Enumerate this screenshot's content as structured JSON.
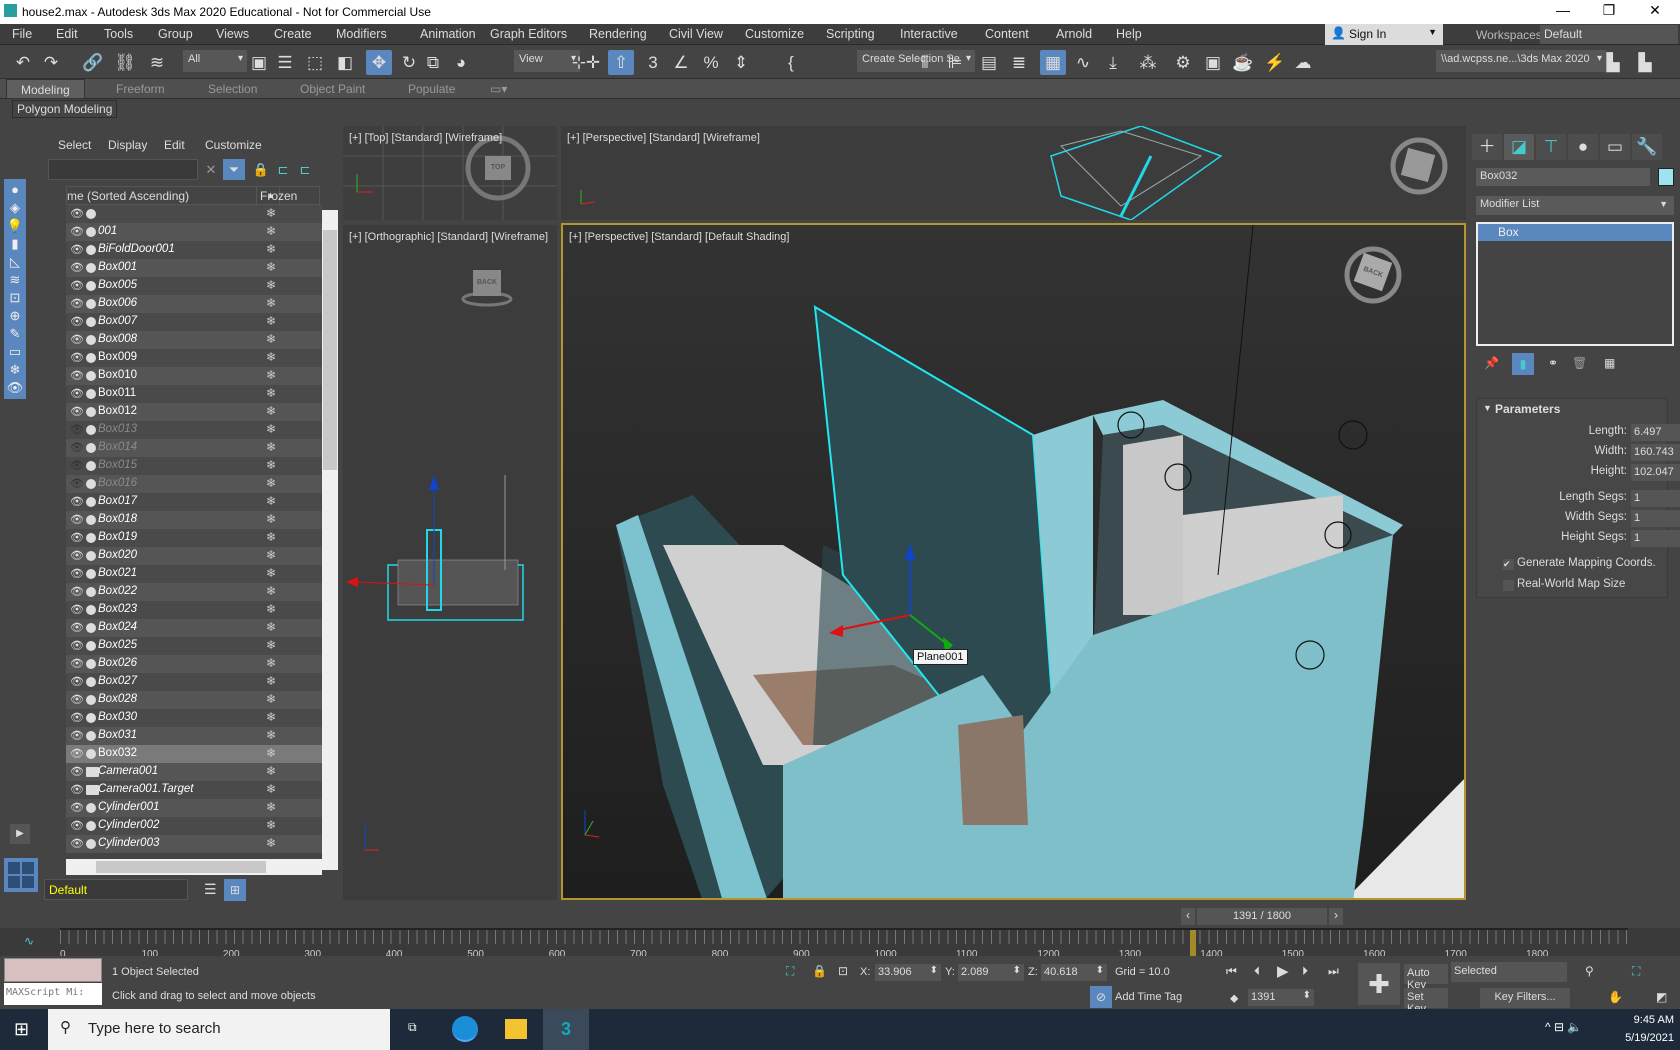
{
  "window": {
    "title": "house2.max - Autodesk 3ds Max 2020 Educational - Not for Commercial Use",
    "controls": [
      "—",
      "❐",
      "✕"
    ]
  },
  "menu": [
    "File",
    "Edit",
    "Tools",
    "Group",
    "Views",
    "Create",
    "Modifiers",
    "Animation",
    "Graph Editors",
    "Rendering",
    "Civil View",
    "Customize",
    "Scripting",
    "Interactive",
    "Content",
    "Arnold",
    "Help"
  ],
  "signin": "Sign In",
  "workspaces": {
    "label": "Workspaces:",
    "value": "Default"
  },
  "toolbar": {
    "filter": "All",
    "refcoord": "View",
    "selset": "Create Selection Se",
    "project": "\\\\ad.wcpss.ne...\\3ds Max 2020",
    "icons": [
      "undo",
      "redo",
      "link",
      "unlink",
      "bind-space-warp",
      "select",
      "select-by-name",
      "rect-region",
      "window-crossing",
      "move",
      "rotate",
      "scale",
      "placement",
      "pivot",
      "snap-toggle",
      "manipulate",
      "snaps-3d",
      "angle-snap",
      "percent-snap",
      "spinner-snap",
      "edit-named-sets",
      "mirror",
      "align",
      "toggle-scene-explorer",
      "toggle-layer-explorer",
      "toggle-ribbon",
      "curve-editor",
      "schematic-view",
      "material-editor",
      "render-setup",
      "rendered-frame-window",
      "render",
      "render-iterative",
      "render-in-cloud",
      "project-folder",
      "set-project"
    ]
  },
  "ribbon": {
    "tabs": [
      "Modeling",
      "Freeform",
      "Selection",
      "Object Paint",
      "Populate"
    ],
    "active": "Modeling",
    "panel": "Polygon Modeling"
  },
  "explorer": {
    "menus": [
      "Select",
      "Display",
      "Edit",
      "Customize"
    ],
    "column_name": "me (Sorted Ascending)",
    "column_frozen": "Frozen",
    "rows": [
      {
        "name": "",
        "italic": false
      },
      {
        "name": "001",
        "italic": true
      },
      {
        "name": "BiFoldDoor001",
        "italic": true
      },
      {
        "name": "Box001",
        "italic": true
      },
      {
        "name": "Box005",
        "italic": true
      },
      {
        "name": "Box006",
        "italic": true
      },
      {
        "name": "Box007",
        "italic": true
      },
      {
        "name": "Box008",
        "italic": true
      },
      {
        "name": "Box009",
        "italic": false
      },
      {
        "name": "Box010",
        "italic": false
      },
      {
        "name": "Box011",
        "italic": false
      },
      {
        "name": "Box012",
        "italic": false
      },
      {
        "name": "Box013",
        "italic": true,
        "hidden": true
      },
      {
        "name": "Box014",
        "italic": true,
        "hidden": true
      },
      {
        "name": "Box015",
        "italic": true,
        "hidden": true
      },
      {
        "name": "Box016",
        "italic": true,
        "hidden": true
      },
      {
        "name": "Box017",
        "italic": true
      },
      {
        "name": "Box018",
        "italic": true
      },
      {
        "name": "Box019",
        "italic": true
      },
      {
        "name": "Box020",
        "italic": true
      },
      {
        "name": "Box021",
        "italic": true
      },
      {
        "name": "Box022",
        "italic": true
      },
      {
        "name": "Box023",
        "italic": true
      },
      {
        "name": "Box024",
        "italic": true
      },
      {
        "name": "Box025",
        "italic": true
      },
      {
        "name": "Box026",
        "italic": true
      },
      {
        "name": "Box027",
        "italic": true
      },
      {
        "name": "Box028",
        "italic": true
      },
      {
        "name": "Box030",
        "italic": true
      },
      {
        "name": "Box031",
        "italic": true
      },
      {
        "name": "Box032",
        "italic": false,
        "selected": true
      },
      {
        "name": "Camera001",
        "italic": true,
        "camera": true
      },
      {
        "name": "Camera001.Target",
        "italic": true,
        "camera": true
      },
      {
        "name": "Cylinder001",
        "italic": true
      },
      {
        "name": "Cylinder002",
        "italic": true
      },
      {
        "name": "Cylinder003",
        "italic": true
      }
    ],
    "layer": "Default"
  },
  "viewports": {
    "top": "[+] [Top] [Standard] [Wireframe]",
    "persp_wire": "[+] [Perspective] [Standard] [Wireframe]",
    "ortho": "[+] [Orthographic] [Standard] [Wireframe]",
    "persp_main": "[+] [Perspective] [Standard] [Default Shading]",
    "tooltip": "Plane001",
    "viewcube_top": "TOP",
    "viewcube_back": "BACK"
  },
  "command_panel": {
    "object_name": "Box032",
    "object_color": "#9ee4ee",
    "modifier_list": "Modifier List",
    "stack": [
      "Box"
    ],
    "rollout": "Parameters",
    "params": [
      {
        "label": "Length:",
        "value": "6.497"
      },
      {
        "label": "Width:",
        "value": "160.743"
      },
      {
        "label": "Height:",
        "value": "102.047"
      },
      {
        "label": "Length Segs:",
        "value": "1"
      },
      {
        "label": "Width Segs:",
        "value": "1"
      },
      {
        "label": "Height Segs:",
        "value": "1"
      }
    ],
    "gen_mapping": {
      "label": "Generate Mapping Coords.",
      "checked": true
    },
    "real_world": {
      "label": "Real-World Map Size",
      "checked": false
    }
  },
  "timeline": {
    "frame": "1391 / 1800",
    "current": 1391,
    "max": 1800,
    "ticks": [
      "0",
      "100",
      "200",
      "300",
      "400",
      "500",
      "600",
      "700",
      "800",
      "900",
      "1000",
      "1100",
      "1200",
      "1300",
      "1400",
      "1500",
      "1600",
      "1700",
      "1800"
    ]
  },
  "status": {
    "maxscript": "MAXScript Mi:",
    "selected": "1 Object Selected",
    "prompt": "Click and drag to select and move objects",
    "x": "33.906",
    "y": "2.089",
    "z": "40.618",
    "grid": "Grid = 10.0",
    "add_time_tag": "Add Time Tag",
    "auto_key": "Auto Key",
    "set_key": "Set Key",
    "key_mode": "Selected",
    "key_filters": "Key Filters...",
    "frame": "1391"
  },
  "taskbar": {
    "search": "Type here to search",
    "time": "9:45 AM",
    "date": "5/19/2021"
  }
}
